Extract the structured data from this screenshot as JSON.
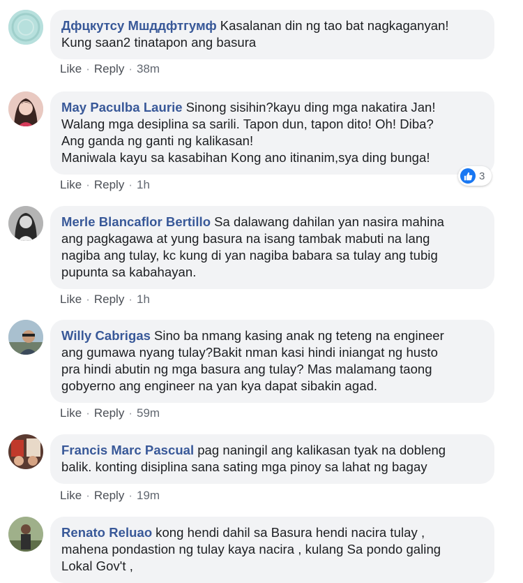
{
  "comments": [
    {
      "author": "Дфцкутсу Мшддфтгумф",
      "lines": [
        "Kasalanan din ng tao bat nagkaganyan!",
        "Kung saan2 tinatapon ang basura"
      ],
      "like_label": "Like",
      "reply_label": "Reply",
      "time": "38m",
      "avatar_color": "#b7e0dd"
    },
    {
      "author": "May Paculba Laurie",
      "lines": [
        "Sinong sisihin?kayu ding mga nakatira Jan!",
        "Walang mga desiplina sa sarili. Tapon dun, tapon dito! Oh! Diba?",
        "Ang ganda ng ganti ng kalikasan!",
        "Maniwala kayu sa kasabihan Kong ano itinanim,sya ding bunga!"
      ],
      "like_label": "Like",
      "reply_label": "Reply",
      "time": "1h",
      "reaction_count": "3",
      "avatar_color": "#e9c9c1"
    },
    {
      "author": "Merle Blancaflor Bertillo",
      "lines": [
        "Sa dalawang dahilan yan nasira mahina",
        "ang pagkagawa at yung basura na isang tambak mabuti na lang",
        "nagiba ang tulay, kc kung di yan nagiba babara sa tulay ang tubig",
        "pupunta sa kabahayan."
      ],
      "like_label": "Like",
      "reply_label": "Reply",
      "time": "1h",
      "avatar_color": "#9a9a9a"
    },
    {
      "author": "Willy Cabrigas",
      "lines": [
        "Sino ba nmang kasing anak ng teteng na engineer",
        "ang gumawa nyang tulay?Bakit nman kasi hindi iniangat ng husto",
        "pra hindi abutin ng mga basura ang tulay? Mas malamang taong",
        "gobyerno ang engineer na yan kya dapat sibakin agad."
      ],
      "like_label": "Like",
      "reply_label": "Reply",
      "time": "59m",
      "avatar_color": "#8fa7b8"
    },
    {
      "author": "Francis Marc Pascual",
      "lines": [
        "pag naningil ang kalikasan tyak na dobleng",
        "balik. konting disiplina sana sating mga pinoy sa lahat ng bagay"
      ],
      "like_label": "Like",
      "reply_label": "Reply",
      "time": "19m",
      "avatar_color": "#7a4a3a"
    },
    {
      "author": "Renato Reluao",
      "lines": [
        "kong hendi dahil sa Basura hendi nacira tulay ,",
        "mahena pondastion ng tulay kaya nacira , kulang Sa pondo galing",
        "Lokal Gov't ,"
      ],
      "avatar_color": "#7d8a6a"
    }
  ],
  "colors": {
    "author_link": "#385898",
    "bubble_bg": "#f2f3f5",
    "action_text": "#616770",
    "like_blue": "#1877f2"
  },
  "icons": {
    "reaction": "like-thumb-icon"
  }
}
